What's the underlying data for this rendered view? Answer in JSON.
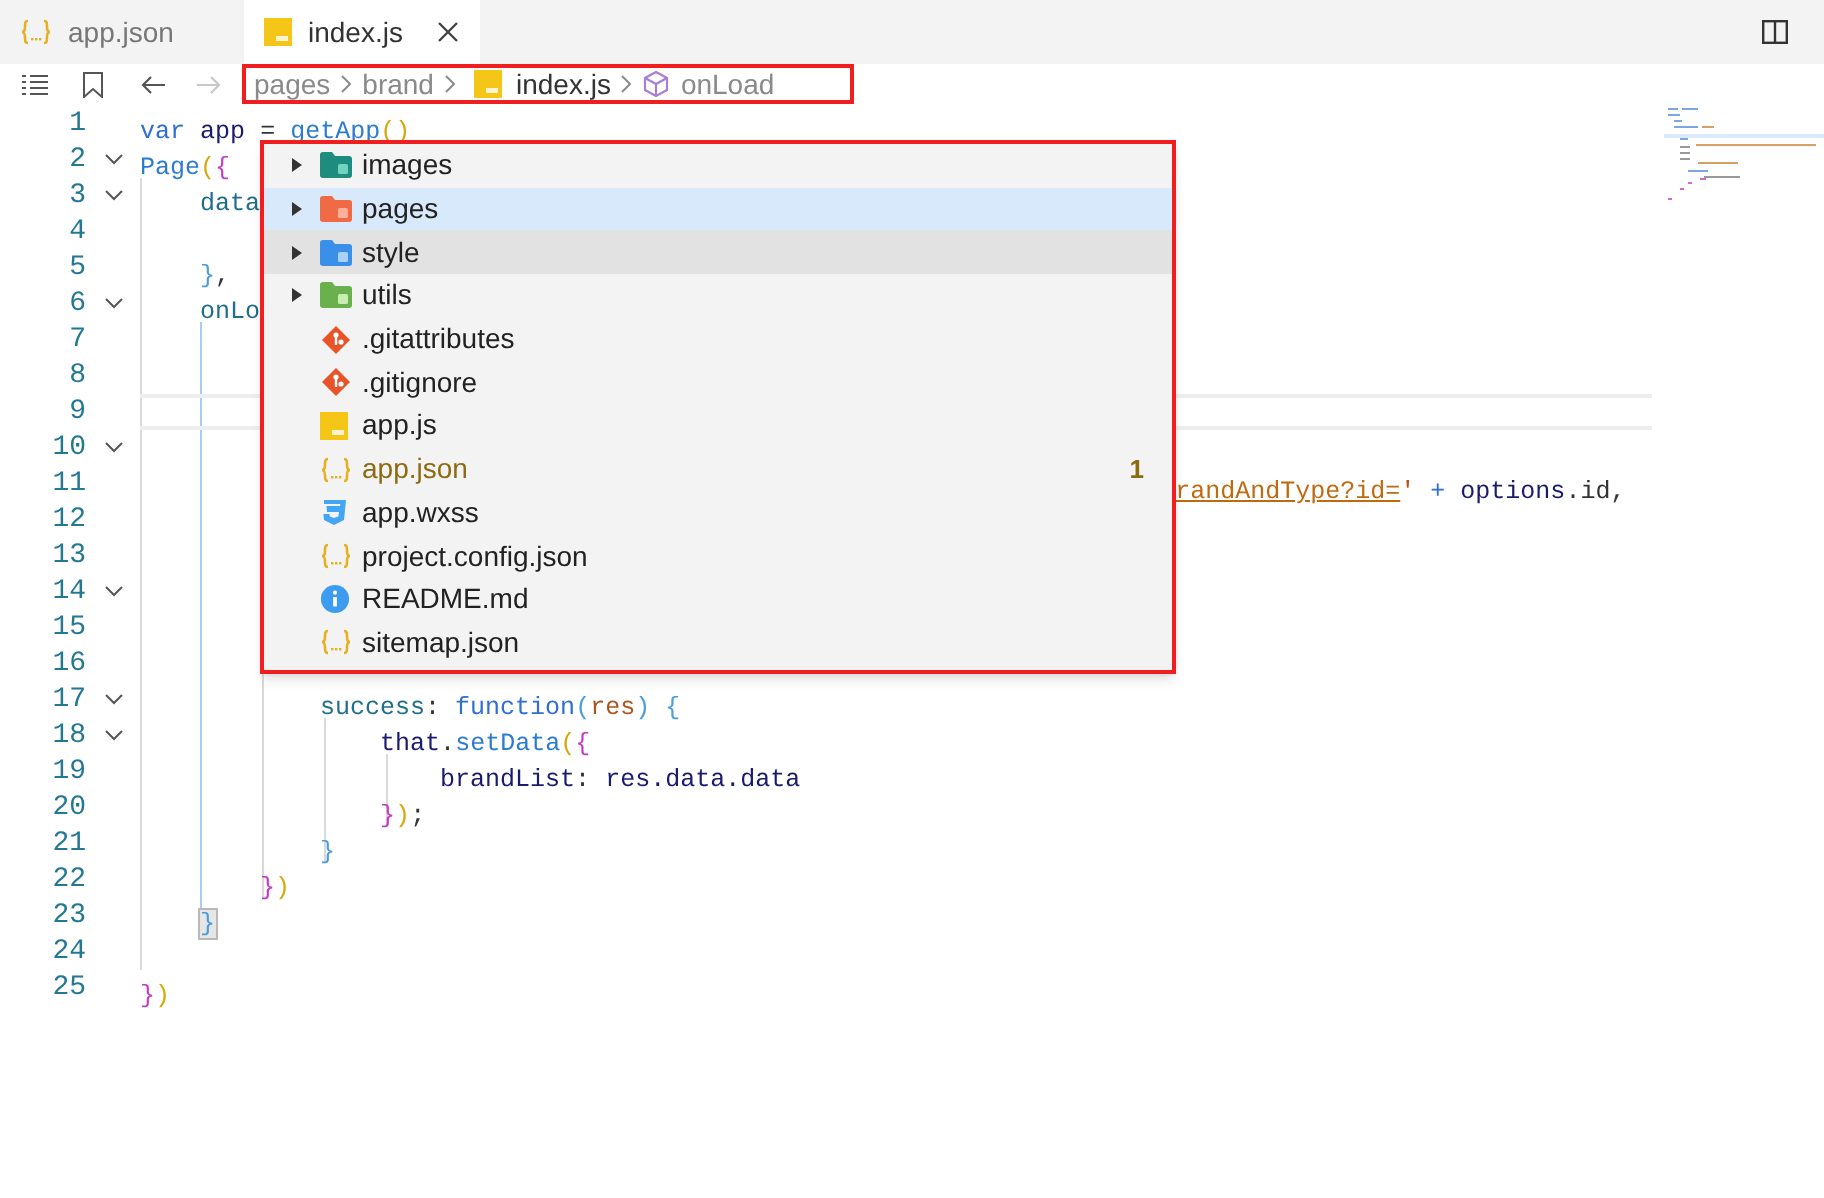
{
  "tabs": [
    {
      "label": "app.json",
      "kind": "json",
      "selected": false
    },
    {
      "label": "index.js",
      "kind": "js",
      "selected": true
    }
  ],
  "breadcrumb": [
    {
      "label": "pages",
      "kind": "folder"
    },
    {
      "label": "brand",
      "kind": "folder"
    },
    {
      "label": "index.js",
      "kind": "js"
    },
    {
      "label": "onLoad",
      "kind": "method"
    }
  ],
  "editor": {
    "lines": [
      {
        "number": "1",
        "foldable": false,
        "current": false,
        "tokens": [
          {
            "text": "var",
            "kind": "keyword"
          },
          {
            "text": " app",
            "kind": "variable"
          },
          {
            "text": " = ",
            "kind": "operator"
          },
          {
            "text": "getApp",
            "kind": "function"
          },
          {
            "text": "()",
            "kind": "bracket1"
          }
        ]
      },
      {
        "number": "2",
        "foldable": true,
        "current": false,
        "tokens": [
          {
            "text": "Page",
            "kind": "function"
          },
          {
            "text": "(",
            "kind": "bracket1"
          },
          {
            "text": "{",
            "kind": "bracket2"
          }
        ]
      },
      {
        "number": "3",
        "foldable": true,
        "current": false,
        "tokens": [
          {
            "text": "    data",
            "kind": "property"
          }
        ]
      },
      {
        "number": "4",
        "foldable": false,
        "current": false
      },
      {
        "number": "5",
        "foldable": false,
        "current": false,
        "tokens": [
          {
            "text": "    }",
            "kind": "bracket3"
          },
          {
            "text": ",",
            "kind": "operator"
          }
        ]
      },
      {
        "number": "6",
        "foldable": true,
        "current": false,
        "tokens": [
          {
            "text": "    onLo",
            "kind": "property"
          }
        ]
      },
      {
        "number": "7",
        "foldable": false,
        "current": false
      },
      {
        "number": "8",
        "foldable": false,
        "current": false
      },
      {
        "number": "9",
        "foldable": false,
        "current": true
      },
      {
        "number": "10",
        "foldable": true,
        "current": false
      },
      {
        "number": "11",
        "foldable": false,
        "current": false,
        "tokens": [
          {
            "text": "                                                                     randAndType?id=",
            "kind": "link"
          },
          {
            "text": "'",
            "kind": "string"
          },
          {
            "text": " + ",
            "kind": "keyword"
          },
          {
            "text": "options",
            "kind": "variable"
          },
          {
            "text": ".id,",
            "kind": "operator"
          }
        ]
      },
      {
        "number": "12",
        "foldable": false,
        "current": false
      },
      {
        "number": "13",
        "foldable": false,
        "current": false
      },
      {
        "number": "14",
        "foldable": true,
        "current": false
      },
      {
        "number": "15",
        "foldable": false,
        "current": false
      },
      {
        "number": "16",
        "foldable": false,
        "current": false
      },
      {
        "number": "17",
        "foldable": true,
        "current": false,
        "tokens": [
          {
            "text": "            success",
            "kind": "property"
          },
          {
            "text": ": ",
            "kind": "operator"
          },
          {
            "text": "function",
            "kind": "keyword"
          },
          {
            "text": "(",
            "kind": "bracket3"
          },
          {
            "text": "res",
            "kind": "parameter"
          },
          {
            "text": ") {",
            "kind": "bracket3"
          }
        ]
      },
      {
        "number": "18",
        "foldable": true,
        "current": false,
        "tokens": [
          {
            "text": "                that",
            "kind": "variable"
          },
          {
            "text": ".",
            "kind": "operator"
          },
          {
            "text": "setData",
            "kind": "function"
          },
          {
            "text": "(",
            "kind": "bracket1"
          },
          {
            "text": "{",
            "kind": "bracket2"
          }
        ]
      },
      {
        "number": "19",
        "foldable": false,
        "current": false,
        "tokens": [
          {
            "text": "                    brandList",
            "kind": "variable"
          },
          {
            "text": ": ",
            "kind": "operator"
          },
          {
            "text": "res.data.data",
            "kind": "variable"
          }
        ]
      },
      {
        "number": "20",
        "foldable": false,
        "current": false,
        "tokens": [
          {
            "text": "                }",
            "kind": "bracket2"
          },
          {
            "text": ")",
            "kind": "bracket1"
          },
          {
            "text": ";",
            "kind": "operator"
          }
        ]
      },
      {
        "number": "21",
        "foldable": false,
        "current": false,
        "tokens": [
          {
            "text": "            }",
            "kind": "bracket3"
          }
        ]
      },
      {
        "number": "22",
        "foldable": false,
        "current": false,
        "tokens": [
          {
            "text": "        }",
            "kind": "bracket2"
          },
          {
            "text": ")",
            "kind": "bracket1"
          }
        ]
      },
      {
        "number": "23",
        "foldable": false,
        "current": false,
        "tokens": [
          {
            "text": "    }",
            "kind": "matched-bracket"
          }
        ]
      },
      {
        "number": "24",
        "foldable": false,
        "current": false
      },
      {
        "number": "25",
        "foldable": false,
        "current": false,
        "tokens": [
          {
            "text": "}",
            "kind": "bracket2"
          },
          {
            "text": ")",
            "kind": "bracket1"
          }
        ]
      }
    ]
  },
  "dropdown": {
    "items": [
      {
        "name": "images",
        "kind": "images-folder",
        "selected": false,
        "hovered": false
      },
      {
        "name": "pages",
        "kind": "pages-folder",
        "selected": true,
        "hovered": false
      },
      {
        "name": "style",
        "kind": "style-folder",
        "selected": false,
        "hovered": true
      },
      {
        "name": "utils",
        "kind": "utils-folder",
        "selected": false,
        "hovered": false
      },
      {
        "name": ".gitattributes",
        "kind": "git",
        "selected": false,
        "hovered": false
      },
      {
        "name": ".gitignore",
        "kind": "git",
        "selected": false,
        "hovered": false
      },
      {
        "name": "app.js",
        "kind": "js",
        "selected": false,
        "hovered": false
      },
      {
        "name": "app.json",
        "kind": "json",
        "selected": false,
        "hovered": false,
        "badge": "1"
      },
      {
        "name": "app.wxss",
        "kind": "css",
        "selected": false,
        "hovered": false
      },
      {
        "name": "project.config.json",
        "kind": "json",
        "selected": false,
        "hovered": false
      },
      {
        "name": "README.md",
        "kind": "info",
        "selected": false,
        "hovered": false
      },
      {
        "name": "sitemap.json",
        "kind": "json",
        "selected": false,
        "hovered": false
      }
    ]
  }
}
